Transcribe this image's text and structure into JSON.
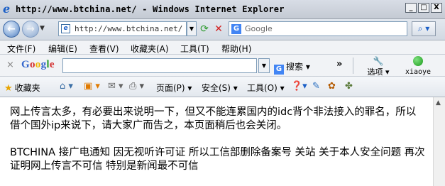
{
  "window": {
    "title": "http://www.btchina.net/ - Windows Internet Explorer",
    "minimize": "_",
    "maximize": "□",
    "close": "X"
  },
  "address_bar": {
    "url": "http://www.btchina.net/",
    "search_placeholder": "Google"
  },
  "menu": {
    "items": [
      "文件(F)",
      "编辑(E)",
      "查看(V)",
      "收藏夹(A)",
      "工具(T)",
      "帮助(H)"
    ]
  },
  "google_toolbar": {
    "logo": "Google",
    "search_label": "搜索",
    "more": "»",
    "options_label": "选项",
    "user_label": "xiaoye"
  },
  "command_bar": {
    "favorites_label": "收藏夹",
    "page_label": "页面(P)",
    "safety_label": "安全(S)",
    "tools_label": "工具(O)"
  },
  "content": {
    "paragraph1": "网上传言太多，有必要出来说明一下，但又不能连累国内的idc背个非法接入的罪名，所以借个国外ip来说下，请大家广而告之，本页面稍后也会关闭。",
    "paragraph2": "BTCHINA 接广电通知 因无视听许可证 所以工信部删除备案号 关站 关于本人安全问题 再次证明网上传言不可信 特别是新闻最不可信"
  }
}
